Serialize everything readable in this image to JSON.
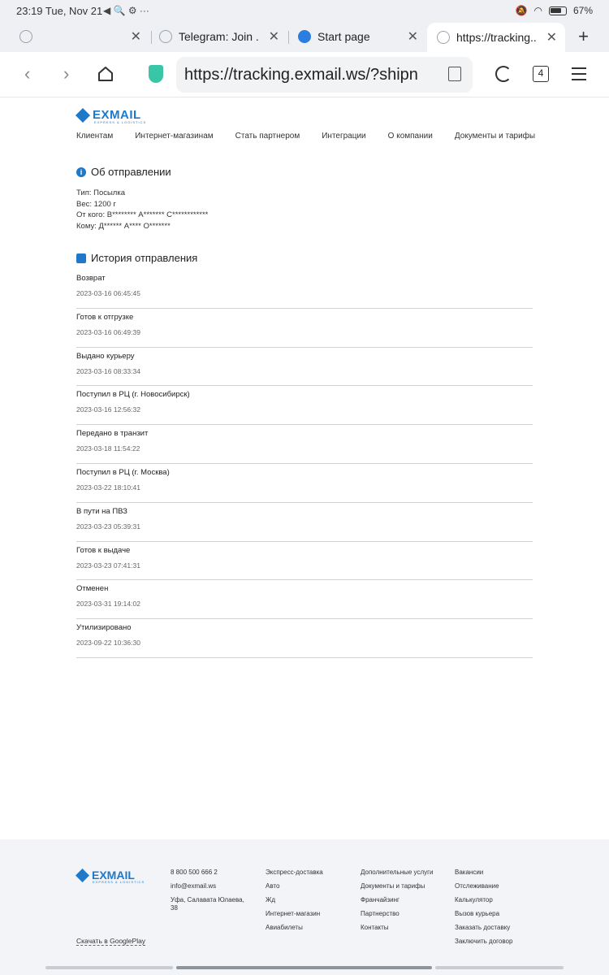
{
  "status_bar": {
    "time": "23:19 Tue, Nov 21",
    "extra": "◀ 🔍 ⚙ ···",
    "battery": "67%"
  },
  "tabs": [
    {
      "label": "",
      "icon": "link-icon"
    },
    {
      "label": "Telegram: Join ...",
      "icon": "link-icon"
    },
    {
      "label": "Start page",
      "icon": "home-icon"
    },
    {
      "label": "https://tracking....",
      "icon": "link-icon"
    }
  ],
  "toolbar": {
    "url": "https://tracking.exmail.ws/?shipn",
    "tab_count": "4"
  },
  "site": {
    "logo": "EXMAIL",
    "logo_sub": "EXPRESS & LOGISTICS",
    "nav": [
      "Клиентам",
      "Интернет-магазинам",
      "Стать партнером",
      "Интеграции",
      "О компании",
      "Документы и тарифы"
    ]
  },
  "shipment": {
    "title": "Об отправлении",
    "type": "Тип: Посылка",
    "weight": "Вес: 1200 г",
    "from": "От кого: В******** А******* С************",
    "to": "Кому: Д****** А**** О*******"
  },
  "history": {
    "title": "История отправления",
    "rows": [
      {
        "status": "Возврат",
        "date": "2023-03-16 06:45:45"
      },
      {
        "status": "Готов к отгрузке",
        "date": "2023-03-16 06:49:39"
      },
      {
        "status": "Выдано курьеру",
        "date": "2023-03-16 08:33:34"
      },
      {
        "status": "Поступил в РЦ (г. Новосибирск)",
        "date": "2023-03-16 12:56:32"
      },
      {
        "status": "Передано в транзит",
        "date": "2023-03-18 11:54:22"
      },
      {
        "status": "Поступил в РЦ (г. Москва)",
        "date": "2023-03-22 18:10:41"
      },
      {
        "status": "В пути на ПВЗ",
        "date": "2023-03-23 05:39:31"
      },
      {
        "status": "Готов к выдаче",
        "date": "2023-03-23 07:41:31"
      },
      {
        "status": "Отменен",
        "date": "2023-03-31 19:14:02"
      },
      {
        "status": "Утилизировано",
        "date": "2023-09-22 10:36:30"
      }
    ]
  },
  "footer": {
    "phone": "8 800 500 666 2",
    "email": "info@exmail.ws",
    "address": "Уфа, Салавата Юлаева, 38",
    "google_play": "Скачать в GooglePlay",
    "col1": [
      "Экспресс-доставка",
      "Авто",
      "Жд",
      "Интернет-магазин",
      "Авиабилеты"
    ],
    "col2": [
      "Дополнительные услуги",
      "Документы и тарифы",
      "Франчайзинг",
      "Партнерство",
      "Контакты"
    ],
    "col3": [
      "Вакансии",
      "Отслеживание",
      "Калькулятор",
      "Вызов курьера",
      "Заказать доставку",
      "Заключить договор"
    ]
  },
  "colors": {
    "brand": "#1f78c8",
    "shield": "#38c6a7"
  }
}
